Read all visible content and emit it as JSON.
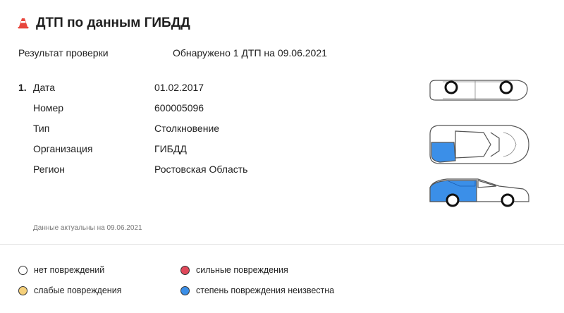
{
  "header": {
    "title": "ДТП по данным ГИБДД",
    "icon": "traffic-cone-icon",
    "icon_color": "#e8453c"
  },
  "result": {
    "label": "Результат проверки",
    "value": "Обнаружено 1 ДТП на 09.06.2021"
  },
  "accident": {
    "number": "1.",
    "rows": [
      {
        "key": "Дата",
        "value": "01.02.2017"
      },
      {
        "key": "Номер",
        "value": "600005096"
      },
      {
        "key": "Тип",
        "value": "Столкновение"
      },
      {
        "key": "Организация",
        "value": "ГИБДД"
      },
      {
        "key": "Регион",
        "value": "Ростовская Область"
      }
    ]
  },
  "note": "Данные актуальны на 09.06.2021",
  "legend": [
    {
      "label": "нет повреждений",
      "color": "#ffffff"
    },
    {
      "label": "слабые повреждения",
      "color": "#f5d07a"
    },
    {
      "label": "сильные повреждения",
      "color": "#e0485a"
    },
    {
      "label": "степень повреждения неизвестна",
      "color": "#3b8fe8"
    }
  ],
  "damage_color": "#3b8fe8"
}
